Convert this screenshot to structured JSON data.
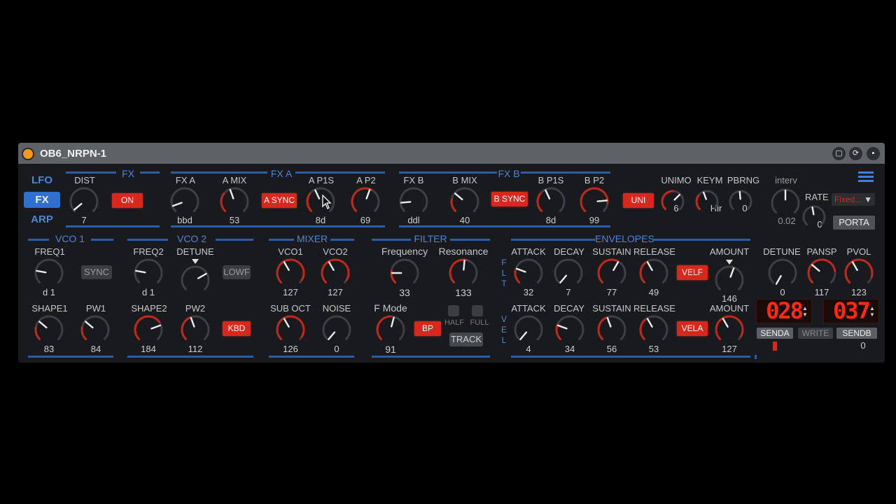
{
  "device": {
    "title": "OB6_NRPN-1",
    "title_icons": [
      "expand-icon",
      "refresh-icon",
      "save-icon"
    ]
  },
  "nav": {
    "items": [
      "LFO",
      "FX",
      "ARP"
    ],
    "active": "FX"
  },
  "fx": {
    "section": "FX",
    "dist": {
      "label": "DIST",
      "value": "7"
    },
    "on_label": "ON",
    "fxa_section": "FX A",
    "fxa": {
      "label": "FX A",
      "value": "bbd"
    },
    "amix": {
      "label": "A MIX",
      "value": "53"
    },
    "async_label": "A SYNC",
    "ap1s": {
      "label": "A P1S",
      "value": "8d"
    },
    "ap2": {
      "label": "A P2",
      "value": "69"
    },
    "fxb_section": "FX B",
    "fxb": {
      "label": "FX B",
      "value": "ddl"
    },
    "bmix": {
      "label": "B MIX",
      "value": "40"
    },
    "bsync_label": "B SYNC",
    "bp1s": {
      "label": "B P1S",
      "value": "8d"
    },
    "bp2": {
      "label": "B P2",
      "value": "99"
    }
  },
  "top_right": {
    "uni_label": "UNI",
    "unimo": {
      "label": "UNIMO",
      "value": "6"
    },
    "keym": {
      "label": "KEYM",
      "value": "Hir"
    },
    "pbrng": {
      "label": "PBRNG",
      "value": "0"
    },
    "interv": {
      "label": "interv",
      "value": "0.02"
    },
    "rate": {
      "label": "RATE",
      "value": "0"
    },
    "rate_mode": "Fixed...",
    "porta_label": "PORTA"
  },
  "vco1": {
    "section": "VCO 1",
    "freq1": {
      "label": "FREQ1",
      "value": "d 1"
    },
    "sync_label": "SYNC",
    "shape1": {
      "label": "SHAPE1",
      "value": "83"
    },
    "pw1": {
      "label": "PW1",
      "value": "84"
    }
  },
  "vco2": {
    "section": "VCO 2",
    "freq2": {
      "label": "FREQ2",
      "value": "d 1"
    },
    "detune": {
      "label": "DETUNE"
    },
    "lowf_label": "LOWF",
    "shape2": {
      "label": "SHAPE2",
      "value": "184"
    },
    "pw2": {
      "label": "PW2",
      "value": "112"
    },
    "kbd_label": "KBD"
  },
  "mixer": {
    "section": "MIXER",
    "vco1": {
      "label": "VCO1",
      "value": "127"
    },
    "vco2": {
      "label": "VCO2",
      "value": "127"
    },
    "suboct": {
      "label": "SUB OCT",
      "value": "126"
    },
    "noise": {
      "label": "NOISE",
      "value": "0"
    }
  },
  "filter": {
    "section": "FILTER",
    "freq": {
      "label": "Frequency",
      "value": "33"
    },
    "res": {
      "label": "Resonance",
      "value": "133"
    },
    "fmode": {
      "label": "F Mode",
      "value": "91"
    },
    "bp_label": "BP",
    "half_label": "HALF",
    "full_label": "FULL",
    "track_label": "TRACK"
  },
  "envelopes": {
    "section": "ENVELOPES",
    "flt_letters": [
      "F",
      "L",
      "T"
    ],
    "vel_letters": [
      "V",
      "E",
      "L"
    ],
    "f_attack": {
      "label": "ATTACK",
      "value": "32"
    },
    "f_decay": {
      "label": "DECAY",
      "value": "7"
    },
    "f_sustain": {
      "label": "SUSTAIN",
      "value": "77"
    },
    "f_release": {
      "label": "RELEASE",
      "value": "49"
    },
    "velf_label": "VELF",
    "f_amount": {
      "label": "AMOUNT",
      "value": "146"
    },
    "v_attack": {
      "label": "ATTACK",
      "value": "4"
    },
    "v_decay": {
      "label": "DECAY",
      "value": "34"
    },
    "v_sustain": {
      "label": "SUSTAIN",
      "value": "56"
    },
    "v_release": {
      "label": "RELEASE",
      "value": "53"
    },
    "vela_label": "VELA",
    "v_amount": {
      "label": "AMOUNT",
      "value": "127"
    }
  },
  "global": {
    "detune": {
      "label": "DETUNE",
      "value": "0"
    },
    "pansp": {
      "label": "PANSP",
      "value": "117"
    },
    "pvol": {
      "label": "PVOL",
      "value": "123"
    },
    "led_a": "028",
    "led_b": "037",
    "senda_label": "SENDA",
    "write_label": "WRITE",
    "sendb_label": "SENDB",
    "send_value": "0"
  },
  "colors": {
    "accent": "#2e6fcf",
    "button_on": "#d8281e",
    "knob_arc": "#c0281c",
    "panel": "#181a1d"
  }
}
